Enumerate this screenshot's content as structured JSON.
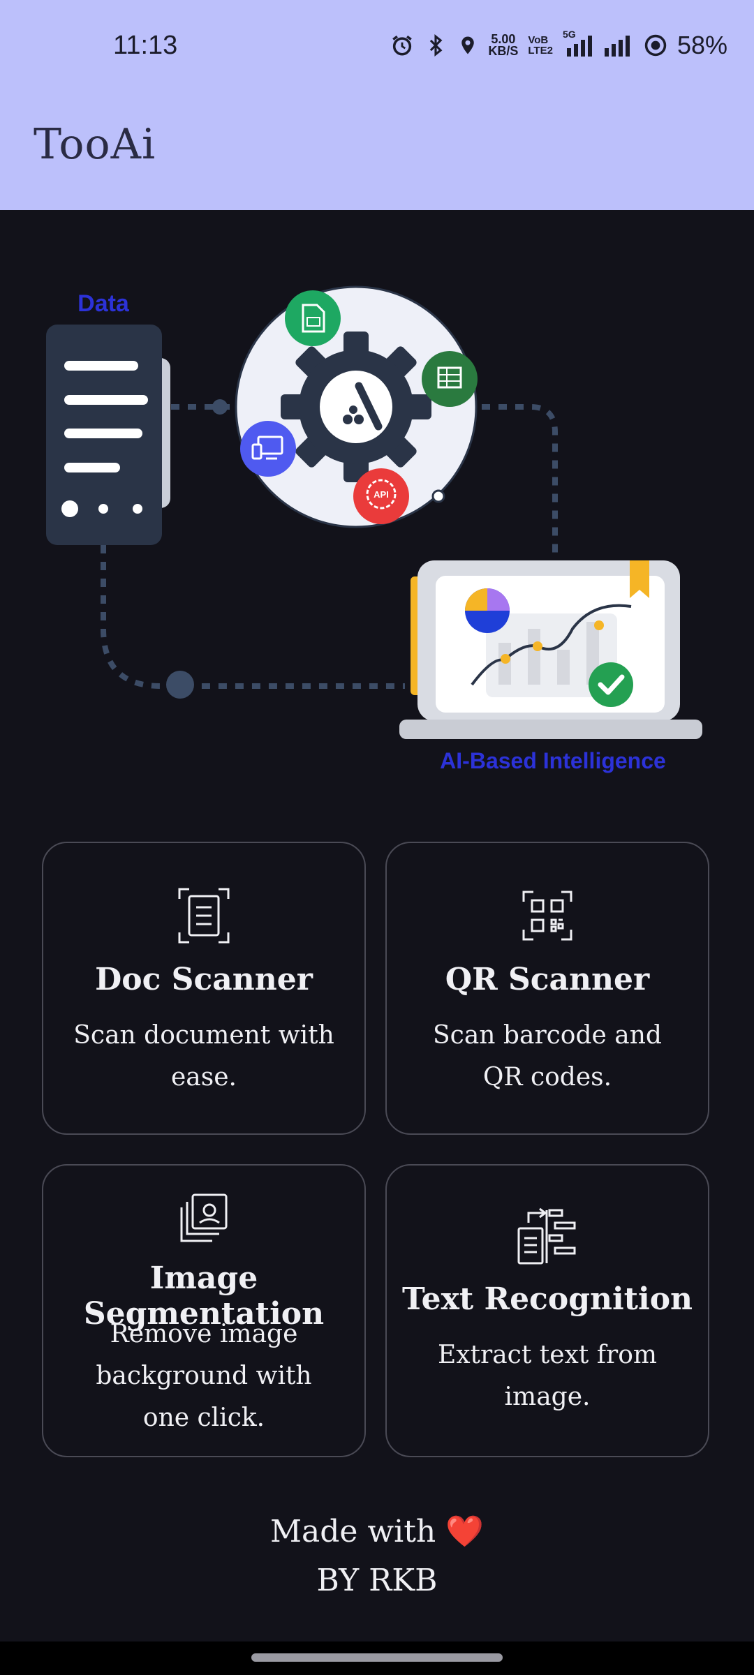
{
  "status": {
    "time": "11:13",
    "net_speed": "5.00",
    "net_unit": "KB/S",
    "volte_top": "VoB",
    "volte_bottom": "LTE2",
    "network": "5G",
    "battery": "58%"
  },
  "app": {
    "title": "TooAi"
  },
  "hero": {
    "data_label": "Data",
    "ai_label": "AI-Based Intelligence",
    "api_label": "API"
  },
  "cards": [
    {
      "title": "Doc Scanner",
      "desc": "Scan document with ease.",
      "icon": "document-scan-icon"
    },
    {
      "title": "QR Scanner",
      "desc": "Scan barcode and QR codes.",
      "icon": "qr-scan-icon"
    },
    {
      "title": "Image Segmentation",
      "desc": "Remove image background with one click.",
      "icon": "image-stack-icon"
    },
    {
      "title": "Text Recognition",
      "desc": "Extract text from image.",
      "icon": "text-extract-icon"
    }
  ],
  "footer": {
    "line1": "Made with",
    "heart": "❤️",
    "line2": "BY RKB"
  },
  "colors": {
    "appbar": "#bcc0fb",
    "background": "#12121a",
    "card_border": "#4a4a55",
    "accent_blue": "#2c32d8"
  }
}
